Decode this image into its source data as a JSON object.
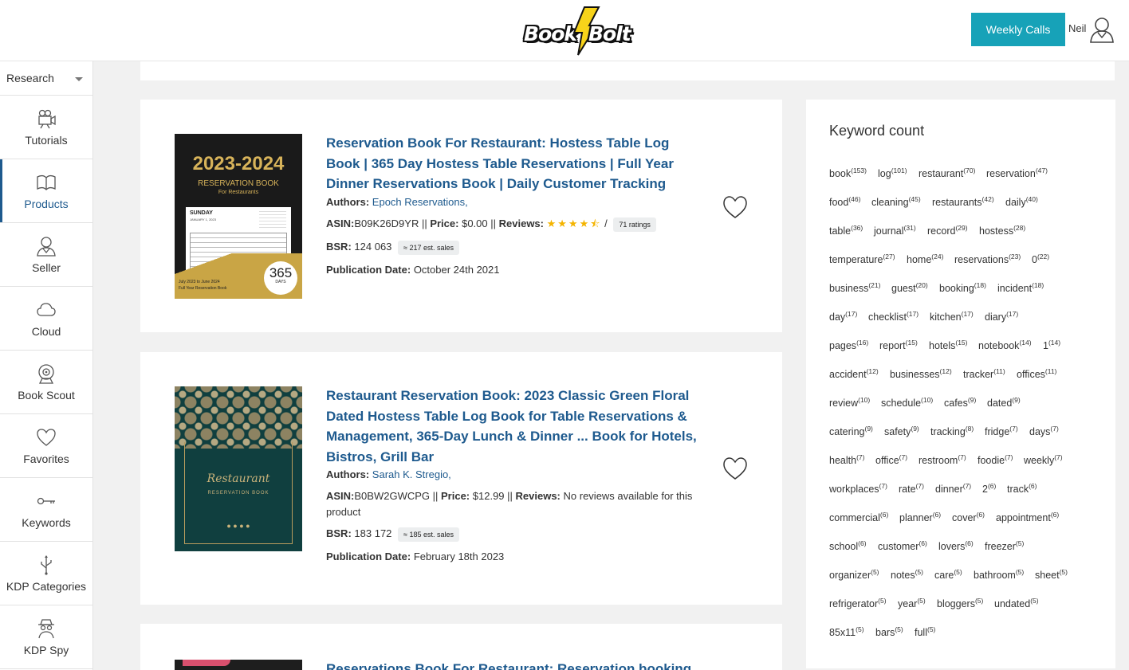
{
  "header": {
    "logo": "BookBolt",
    "logo_left": "Book",
    "logo_right": "Bolt",
    "weekly_calls": "Weekly Calls",
    "user_name": "Neil"
  },
  "sidebar": {
    "select": "Research",
    "items": [
      {
        "label": "Tutorials",
        "icon": "video-camera-icon"
      },
      {
        "label": "Products",
        "icon": "open-book-icon"
      },
      {
        "label": "Seller",
        "icon": "user-icon"
      },
      {
        "label": "Cloud",
        "icon": "cloud-icon"
      },
      {
        "label": "Book Scout",
        "icon": "webcam-icon"
      },
      {
        "label": "Favorites",
        "icon": "heart-icon"
      },
      {
        "label": "Keywords",
        "icon": "key-icon"
      },
      {
        "label": "KDP Categories",
        "icon": "usb-icon"
      },
      {
        "label": "KDP Spy",
        "icon": "spy-icon"
      }
    ]
  },
  "books": [
    {
      "title": "Reservation Book For Restaurant: Hostess Table Log Book | 365 Day Hostess Table Reservations | Full Year Dinner Reservations Book | Daily Customer Tracking",
      "authors_label": "Authors:",
      "author": "Epoch Reservations,",
      "asin_label": "ASIN:",
      "asin": "B09K26D9YR",
      "sep": " || ",
      "price_label": "Price:",
      "price": "$0.00",
      "reviews_label": "Reviews:",
      "rating": 4.5,
      "stars": "★★★★⯪",
      "rating_sep": " / ",
      "ratings_count": "71 ratings",
      "bsr_label": "BSR:",
      "bsr": "124 063",
      "est_sales": "≈ 217 est. sales",
      "pub_label": "Publication Date:",
      "pub_date": "October 24th 2021",
      "cover": {
        "years": "2023-2024",
        "heading": "RESERVATION BOOK",
        "sub": "For Restaurants",
        "day": "SUNDAY",
        "date": "JANUARY 1, 2023",
        "badge": "365",
        "badge_sub": "DAYS",
        "footer1": "July 2023 to June 2024",
        "footer2": "Full Year Reservation Book"
      }
    },
    {
      "title": "Restaurant Reservation Book: 2023 Classic Green Floral Dated Hostess Table Log Book for Table Reservations & Management, 365-Day Lunch & Dinner ... Book for Hotels, Bistros, Grill Bar",
      "authors_label": "Authors:",
      "author": "Sarah K. Stregio,",
      "asin_label": "ASIN:",
      "asin": "B0BW2GWCPG",
      "sep": " || ",
      "price_label": "Price:",
      "price": "$12.99",
      "reviews_label": "Reviews:",
      "reviews_text": "No reviews available for this product",
      "bsr_label": "BSR:",
      "bsr": "183 172",
      "est_sales": "≈ 185 est. sales",
      "pub_label": "Publication Date:",
      "pub_date": "February 18th 2023",
      "cover": {
        "script": "Restaurant",
        "heading": "RESERVATION BOOK"
      }
    },
    {
      "title": "Reservations Book For Restaurant: Reservation booking"
    }
  ],
  "keywords": {
    "title": "Keyword count",
    "rows": [
      [
        [
          "book",
          "153"
        ],
        [
          "log",
          "101"
        ],
        [
          "restaurant",
          "70"
        ],
        [
          "reservation",
          "47"
        ]
      ],
      [
        [
          "food",
          "46"
        ],
        [
          "cleaning",
          "45"
        ],
        [
          "restaurants",
          "42"
        ],
        [
          "daily",
          "40"
        ]
      ],
      [
        [
          "table",
          "36"
        ],
        [
          "journal",
          "31"
        ],
        [
          "record",
          "29"
        ],
        [
          "hostess",
          "28"
        ]
      ],
      [
        [
          "temperature",
          "27"
        ],
        [
          "home",
          "24"
        ],
        [
          "reservations",
          "23"
        ],
        [
          "0",
          "22"
        ]
      ],
      [
        [
          "business",
          "21"
        ],
        [
          "guest",
          "20"
        ],
        [
          "booking",
          "18"
        ],
        [
          "incident",
          "18"
        ]
      ],
      [
        [
          "day",
          "17"
        ],
        [
          "checklist",
          "17"
        ],
        [
          "kitchen",
          "17"
        ],
        [
          "diary",
          "17"
        ]
      ],
      [
        [
          "pages",
          "16"
        ],
        [
          "report",
          "15"
        ],
        [
          "hotels",
          "15"
        ],
        [
          "notebook",
          "14"
        ],
        [
          "1",
          "14"
        ]
      ],
      [
        [
          "accident",
          "12"
        ],
        [
          "businesses",
          "12"
        ],
        [
          "tracker",
          "11"
        ],
        [
          "offices",
          "11"
        ]
      ],
      [
        [
          "review",
          "10"
        ],
        [
          "schedule",
          "10"
        ],
        [
          "cafes",
          "9"
        ],
        [
          "dated",
          "9"
        ]
      ],
      [
        [
          "catering",
          "9"
        ],
        [
          "safety",
          "9"
        ],
        [
          "tracking",
          "8"
        ],
        [
          "fridge",
          "7"
        ],
        [
          "days",
          "7"
        ]
      ],
      [
        [
          "health",
          "7"
        ],
        [
          "office",
          "7"
        ],
        [
          "restroom",
          "7"
        ],
        [
          "foodie",
          "7"
        ],
        [
          "weekly",
          "7"
        ]
      ],
      [
        [
          "workplaces",
          "7"
        ],
        [
          "rate",
          "7"
        ],
        [
          "dinner",
          "7"
        ],
        [
          "2",
          "6"
        ],
        [
          "track",
          "6"
        ]
      ],
      [
        [
          "commercial",
          "6"
        ],
        [
          "planner",
          "6"
        ],
        [
          "cover",
          "6"
        ],
        [
          "appointment",
          "6"
        ]
      ],
      [
        [
          "school",
          "6"
        ],
        [
          "customer",
          "6"
        ],
        [
          "lovers",
          "6"
        ],
        [
          "freezer",
          "5"
        ]
      ],
      [
        [
          "organizer",
          "5"
        ],
        [
          "notes",
          "5"
        ],
        [
          "care",
          "5"
        ],
        [
          "bathroom",
          "5"
        ],
        [
          "sheet",
          "5"
        ]
      ],
      [
        [
          "refrigerator",
          "5"
        ],
        [
          "year",
          "5"
        ],
        [
          "bloggers",
          "5"
        ],
        [
          "undated",
          "5"
        ]
      ],
      [
        [
          "85x11",
          "5"
        ],
        [
          "bars",
          "5"
        ],
        [
          "full",
          "5"
        ]
      ]
    ]
  }
}
